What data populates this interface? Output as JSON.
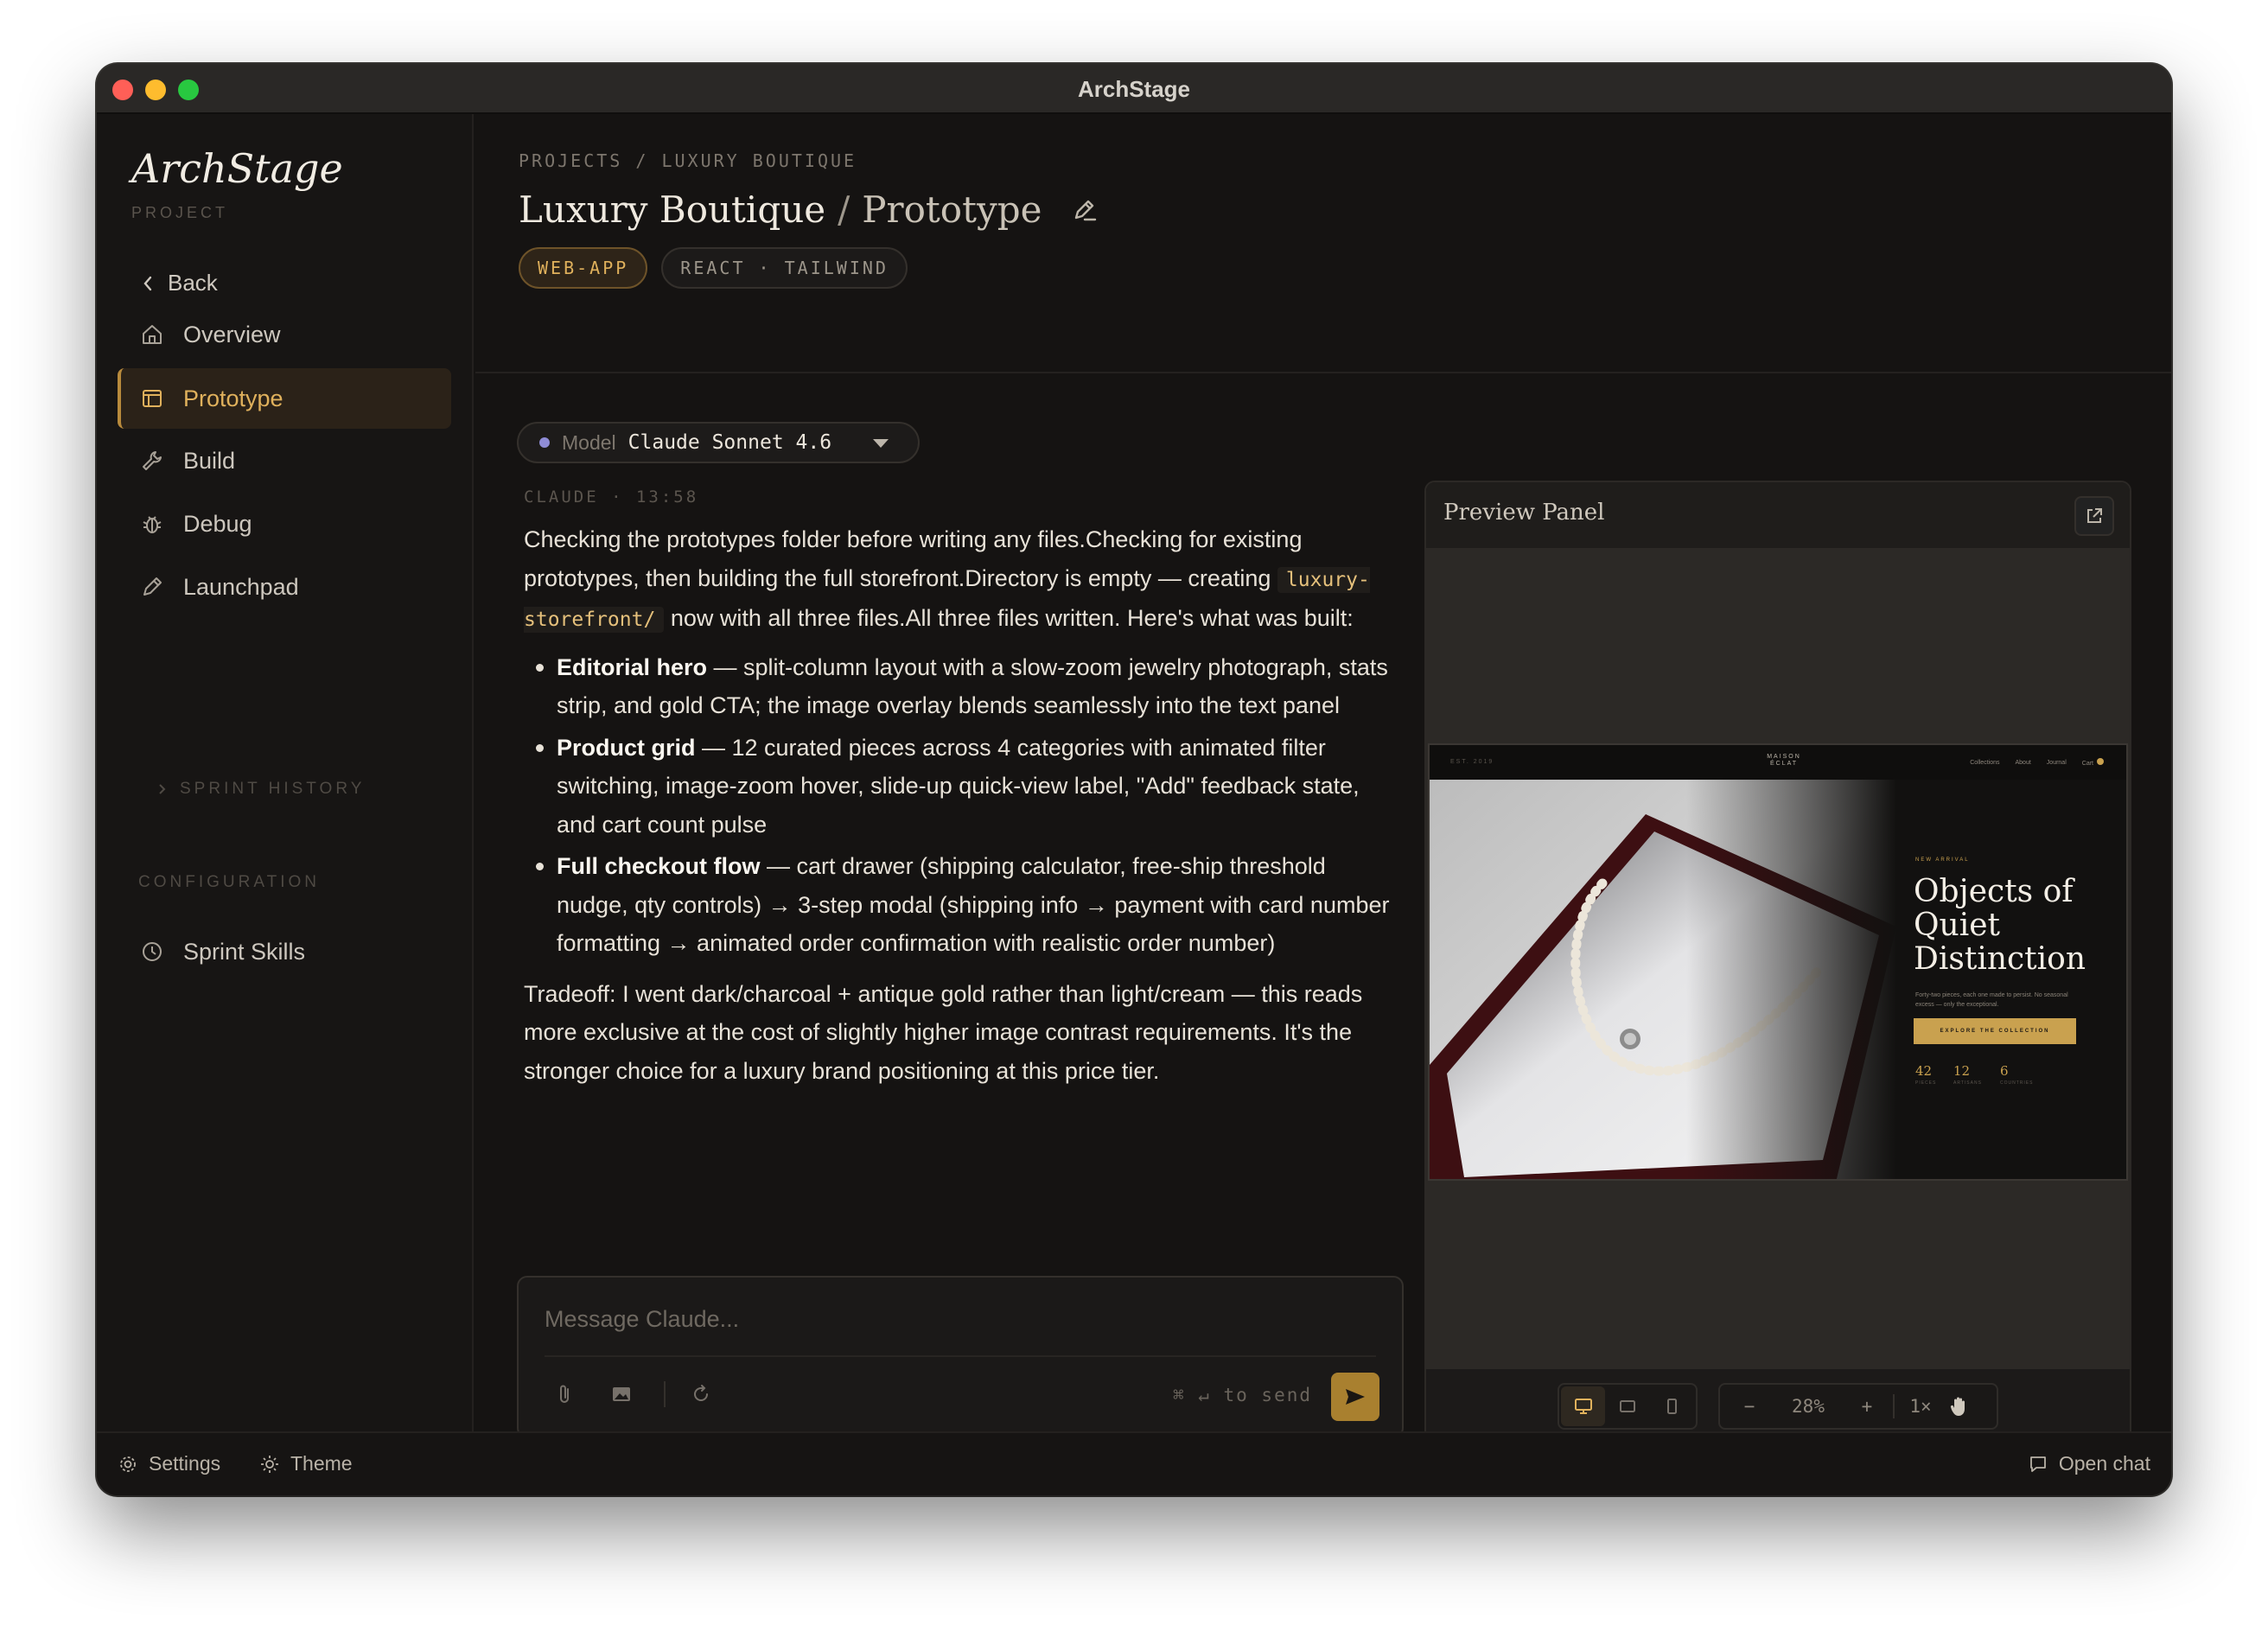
{
  "window": {
    "title": "ArchStage"
  },
  "sidebar": {
    "logo": "ArchStage",
    "logo_sub": "PROJECT",
    "back_label": "Back",
    "items": [
      {
        "label": "Overview",
        "icon": "home-icon"
      },
      {
        "label": "Prototype",
        "icon": "layout-icon",
        "active": true
      },
      {
        "label": "Build",
        "icon": "wrench-icon"
      },
      {
        "label": "Debug",
        "icon": "bug-icon"
      },
      {
        "label": "Launchpad",
        "icon": "pencil-icon"
      }
    ],
    "sprint_history_label": "SPRINT HISTORY",
    "configuration_label": "CONFIGURATION",
    "sprint_skills_label": "Sprint Skills"
  },
  "header": {
    "breadcrumb": "PROJECTS / LUXURY BOUTIQUE",
    "title": "Luxury Boutique",
    "separator": "/",
    "subtitle": "Prototype",
    "tags": [
      "WEB-APP",
      "REACT · TAILWIND"
    ]
  },
  "model": {
    "label": "Model",
    "value": "Claude Sonnet 4.6"
  },
  "message": {
    "meta": "CLAUDE · 13:58",
    "intro_1": "Checking the prototypes folder before writing any files.Checking for existing prototypes, then building the full storefront.Directory is empty — creating ",
    "code": "luxury-storefront/",
    "intro_2": " now with all three files.All three files written. Here's what was built:",
    "bullets": [
      {
        "title": "Editorial hero",
        "text": " — split-column layout with a slow-zoom jewelry photograph, stats strip, and gold CTA; the image overlay blends seamlessly into the text panel"
      },
      {
        "title": "Product grid",
        "text": " — 12 curated pieces across 4 categories with animated filter switching, image-zoom hover, slide-up quick-view label, \"Add\" feedback state, and cart count pulse"
      },
      {
        "title": "Full checkout flow",
        "text": " — cart drawer (shipping calculator, free-ship threshold nudge, qty controls) → 3-step modal (shipping info → payment with card number formatting → animated order confirmation with realistic order number)"
      }
    ],
    "tradeoff": "Tradeoff: I went dark/charcoal + antique gold rather than light/cream — this reads more exclusive at the cost of slightly higher image contrast requirements. It's the stronger choice for a luxury brand positioning at this price tier."
  },
  "composer": {
    "placeholder": "Message Claude...",
    "value": "",
    "send_hint": "⌘ ↵ to send"
  },
  "preview": {
    "title": "Preview Panel",
    "site": {
      "est": "EST. 2019",
      "brand_line1": "MAISON",
      "brand_line2": "ÉCLAT",
      "nav_links": [
        "Collections",
        "About",
        "Journal",
        "Cart"
      ],
      "eyebrow": "NEW ARRIVAL",
      "hero_title": "Objects of Quiet Distinction",
      "hero_sub": "Forty-two pieces, each one made to persist. No seasonal excess — only the exceptional.",
      "cta": "EXPLORE THE COLLECTION",
      "stats": [
        {
          "value": "42",
          "label": "PIECES"
        },
        {
          "value": "12",
          "label": "ARTISANS"
        },
        {
          "value": "6",
          "label": "COUNTRIES"
        }
      ]
    },
    "zoom": "28%",
    "zoom_minus": "−",
    "zoom_plus": "+",
    "scale": "1×"
  },
  "footer": {
    "settings_label": "Settings",
    "theme_label": "Theme",
    "open_chat_label": "Open chat"
  },
  "colors": {
    "accent_gold": "#e0b15c",
    "send_button": "#a9802f",
    "background": "#151312"
  }
}
